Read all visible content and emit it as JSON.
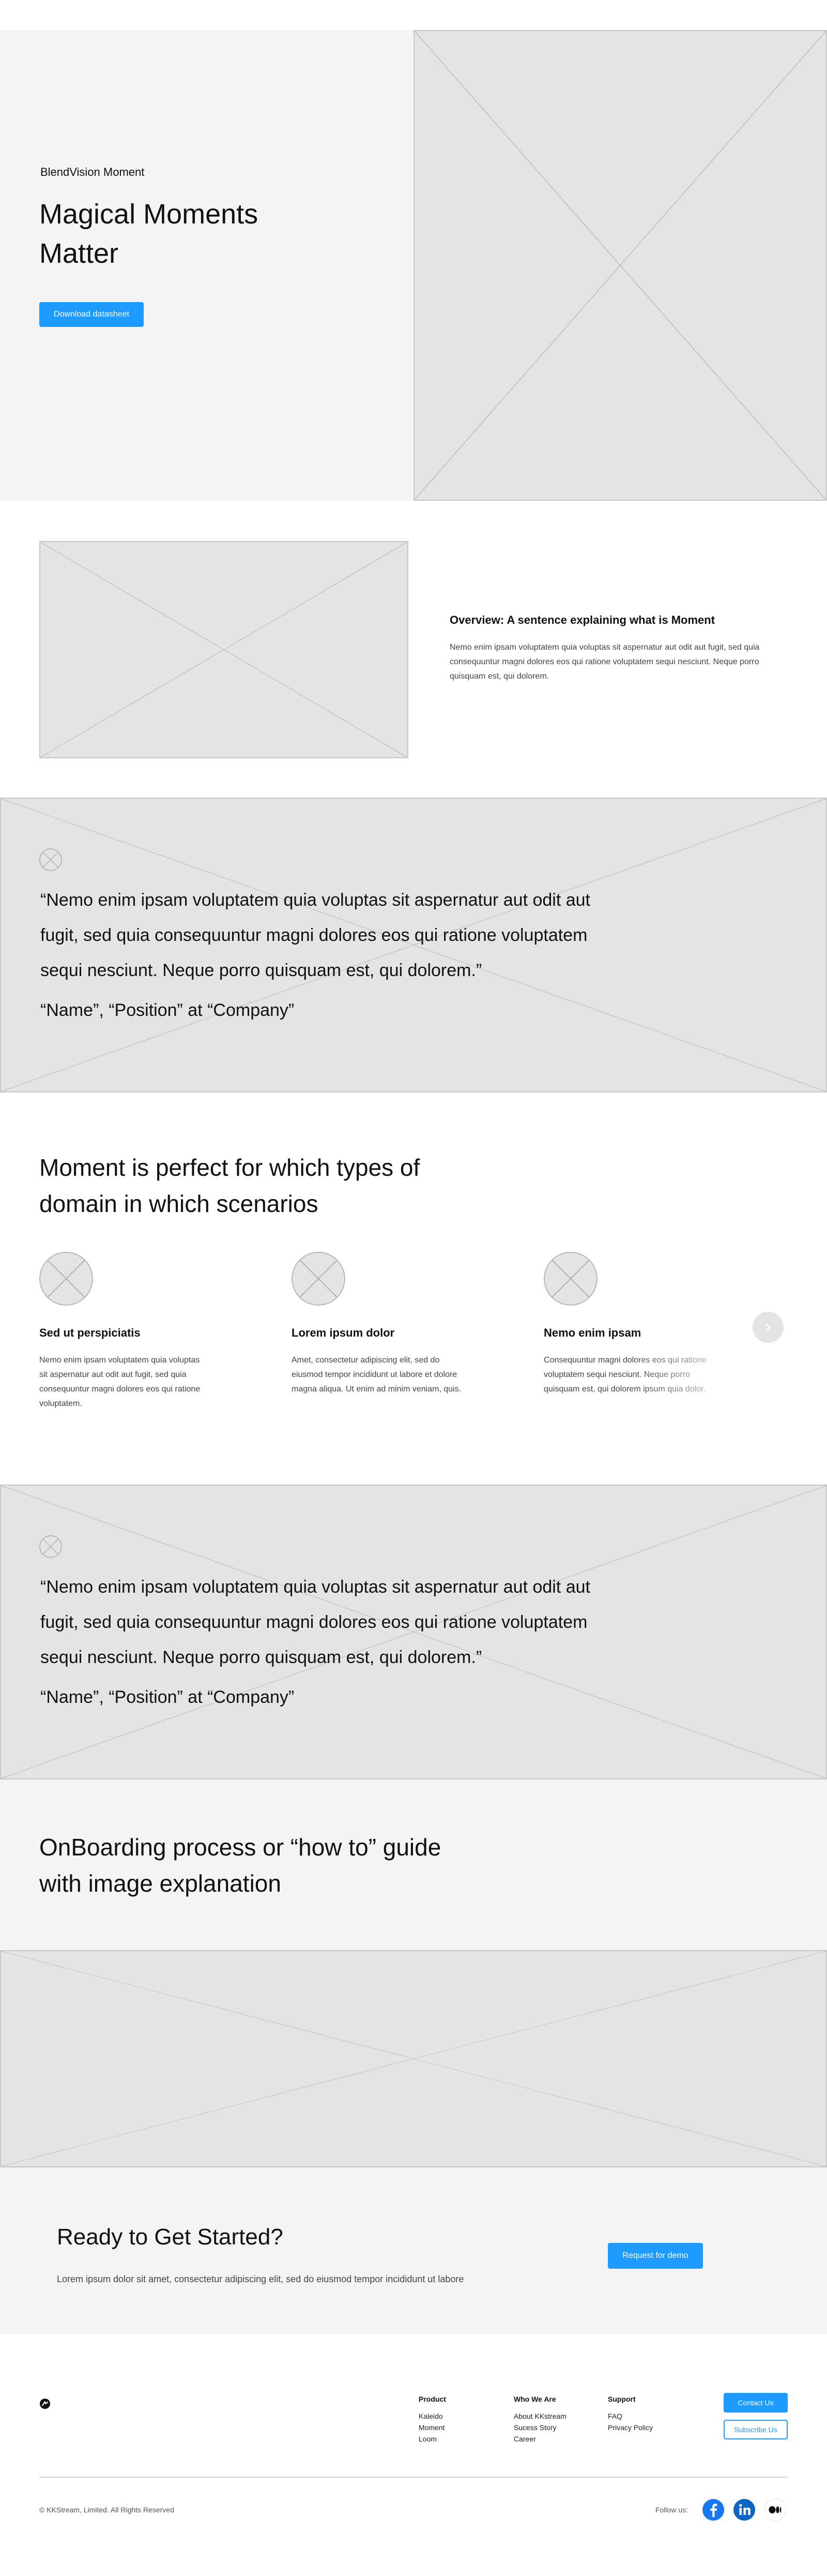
{
  "hero": {
    "eyebrow": "BlendVision Moment",
    "title_line1": "Magical Moments",
    "title_line2": "Matter",
    "cta_label": "Download datasheet"
  },
  "overview": {
    "heading": "Overview: A sentence explaining what is Moment",
    "body": "Nemo enim ipsam voluptatem quia voluptas sit aspernatur aut odit aut fugit, sed quia consequuntur magni dolores eos qui ratione voluptatem sequi nesciunt. Neque porro quisquam est, qui dolorem."
  },
  "testimonial_1": {
    "line1": "“Nemo enim ipsam voluptatem quia voluptas sit aspernatur aut odit aut",
    "line2": "fugit, sed quia consequuntur magni dolores eos qui ratione voluptatem",
    "line3": "sequi nesciunt. Neque porro quisquam est, qui dolorem.”",
    "author": "“Name”, “Position” at “Company”"
  },
  "scenarios": {
    "heading_line1": "Moment is perfect for which types of",
    "heading_line2": "domain in which scenarios",
    "cards": [
      {
        "title": "Sed ut perspiciatis",
        "body": "Nemo enim ipsam voluptatem quia voluptas sit aspernatur aut odit aut fugit, sed quia consequuntur magni dolores eos qui ratione voluptatem."
      },
      {
        "title": "Lorem ipsum dolor",
        "body": "Amet, consectetur adipiscing elit, sed do eiusmod tempor incididunt ut labore et dolore magna aliqua. Ut enim ad minim veniam, quis."
      },
      {
        "title": "Nemo enim ipsam",
        "body": "Consequuntur magni dolores eos qui ratione voluptatem sequi nesciunt. Neque porro quisquam est, qui dolorem ipsum quia dolor."
      }
    ],
    "next_icon": "chevron-right-icon"
  },
  "testimonial_2": {
    "line1": "“Nemo enim ipsam voluptatem quia voluptas sit aspernatur aut odit aut",
    "line2": "fugit, sed quia consequuntur magni dolores eos qui ratione voluptatem",
    "line3": "sequi nesciunt. Neque porro quisquam est, qui dolorem.”",
    "author": "“Name”, “Position” at “Company”"
  },
  "onboarding": {
    "heading_line1": "OnBoarding process or “how to” guide",
    "heading_line2": "with image explanation"
  },
  "cta": {
    "heading": "Ready to Get Started?",
    "body": "Lorem ipsum dolor sit amet, consectetur adipiscing elit, sed do eiusmod tempor incididunt ut labore",
    "button_label": "Request for demo"
  },
  "footer": {
    "columns": [
      {
        "heading": "Product",
        "links": [
          "Kaleido",
          "Moment",
          "Loom"
        ]
      },
      {
        "heading": "Who We Are",
        "links": [
          "About KKstream",
          "Sucess Story",
          "Career"
        ]
      },
      {
        "heading": "Support",
        "links": [
          "FAQ",
          "Privacy Policy"
        ]
      }
    ],
    "contact_label": "Contact Us",
    "subscribe_label": "Subscribe Us",
    "copyright": "© KKStream, Limited. All Rights Reserved",
    "follow_label": "Follow us:",
    "social_icons": [
      "facebook-icon",
      "linkedin-icon",
      "medium-icon"
    ]
  },
  "colors": {
    "accent": "#1e9bff",
    "placeholder": "#e4e4e4",
    "section_bg": "#f4f4f4"
  }
}
